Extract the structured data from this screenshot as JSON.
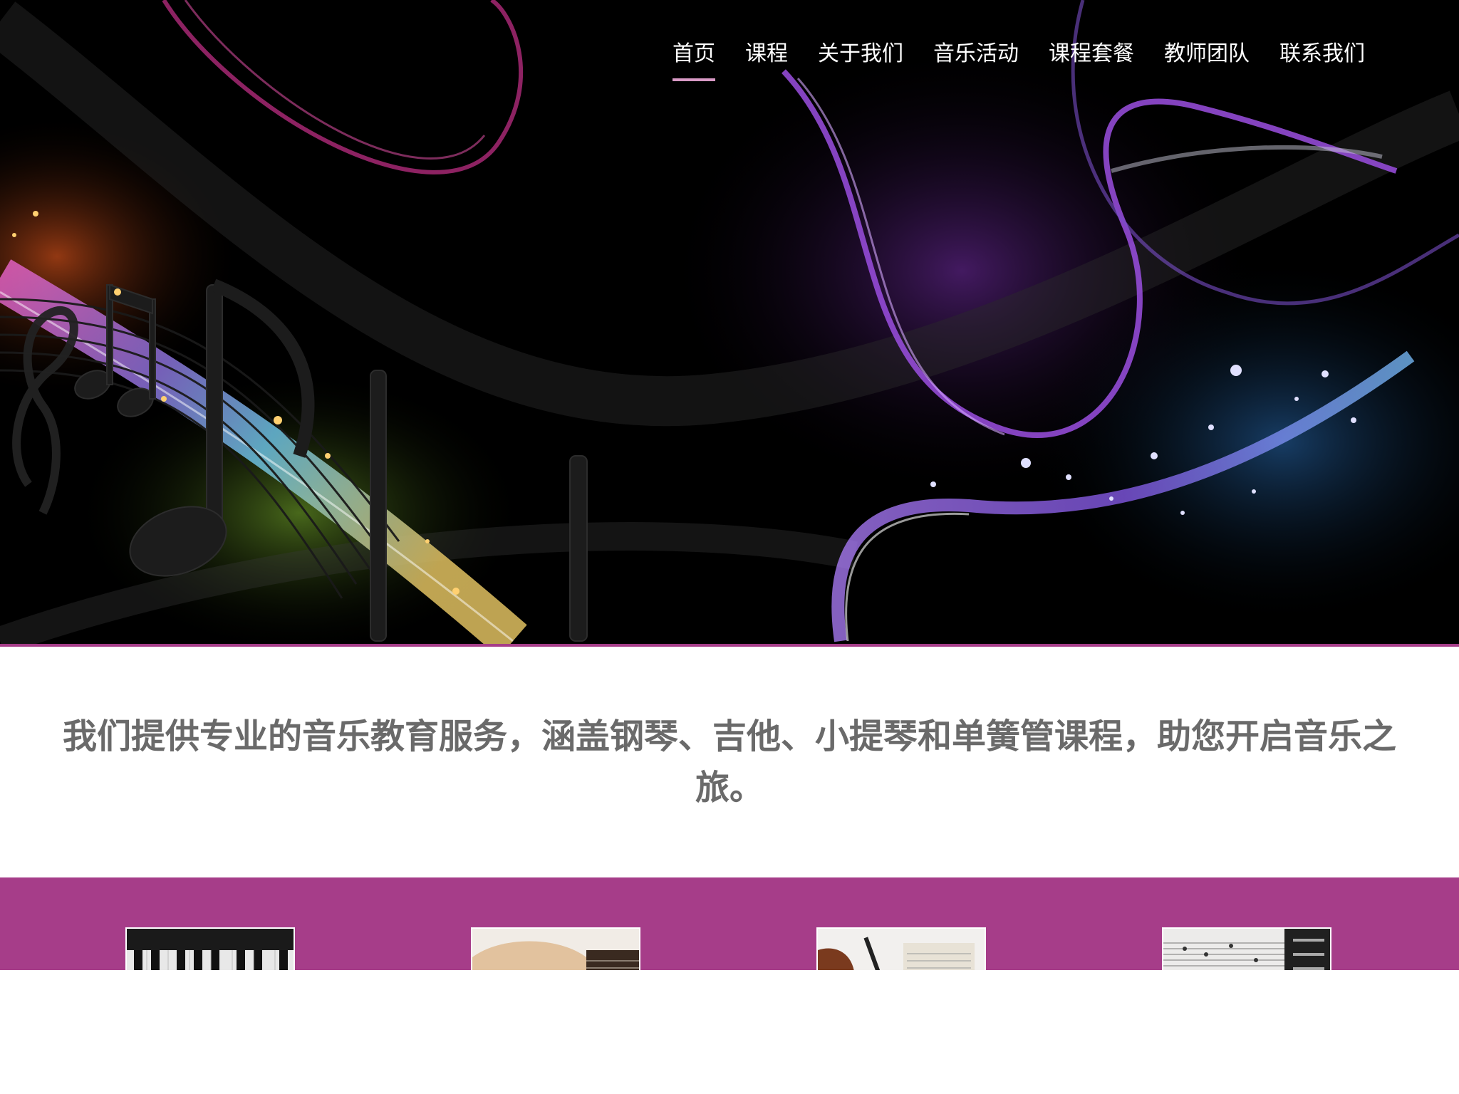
{
  "nav": {
    "items": [
      {
        "label": "首页",
        "active": true
      },
      {
        "label": "课程",
        "active": false
      },
      {
        "label": "关于我们",
        "active": false
      },
      {
        "label": "音乐活动",
        "active": false
      },
      {
        "label": "课程套餐",
        "active": false
      },
      {
        "label": "教师团队",
        "active": false
      },
      {
        "label": "联系我们",
        "active": false
      }
    ]
  },
  "intro": {
    "text": "我们提供专业的音乐教育服务，涵盖钢琴、吉他、小提琴和单簧管课程，助您开启音乐之旅。"
  },
  "courses": {
    "thumbnails": [
      "piano-image",
      "guitar-image",
      "violin-image",
      "clarinet-image"
    ]
  },
  "colors": {
    "brand": "#a63d89",
    "nav_underline": "#d99ac6",
    "intro_text": "#6a6a6a",
    "hero_bg": "#000000"
  }
}
